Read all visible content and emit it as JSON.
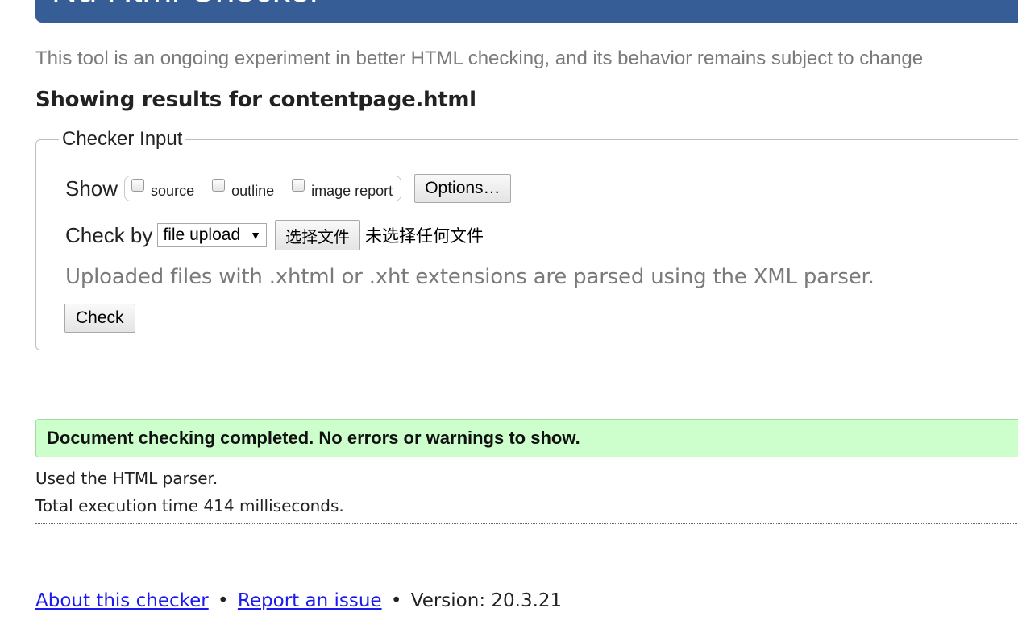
{
  "header": {
    "title": "Nu Html Checker"
  },
  "intro_text": "This tool is an ongoing experiment in better HTML checking, and its behavior remains subject to change",
  "results_heading": "Showing results for contentpage.html",
  "checker_input": {
    "legend": "Checker Input",
    "show_label": "Show",
    "show_options": [
      {
        "label": "source",
        "checked": false
      },
      {
        "label": "outline",
        "checked": false
      },
      {
        "label": "image report",
        "checked": false
      }
    ],
    "options_button": "Options…",
    "check_by_label": "Check by",
    "check_by_value": "file upload",
    "file_button": "选择文件",
    "file_status": "未选择任何文件",
    "hint": "Uploaded files with .xhtml or .xht extensions are parsed using the XML parser.",
    "check_button": "Check"
  },
  "result": {
    "success_message": "Document checking completed. No errors or warnings to show.",
    "parser_note": "Used the HTML parser.",
    "execution_time": "Total execution time 414 milliseconds.",
    "success_color": "#ccffcc"
  },
  "footer": {
    "about_link": "About this checker",
    "bullet": "•",
    "report_link": "Report an issue",
    "version": "Version: 20.3.21"
  },
  "colors": {
    "header_bg": "#365d95",
    "link": "#1a1aee"
  }
}
